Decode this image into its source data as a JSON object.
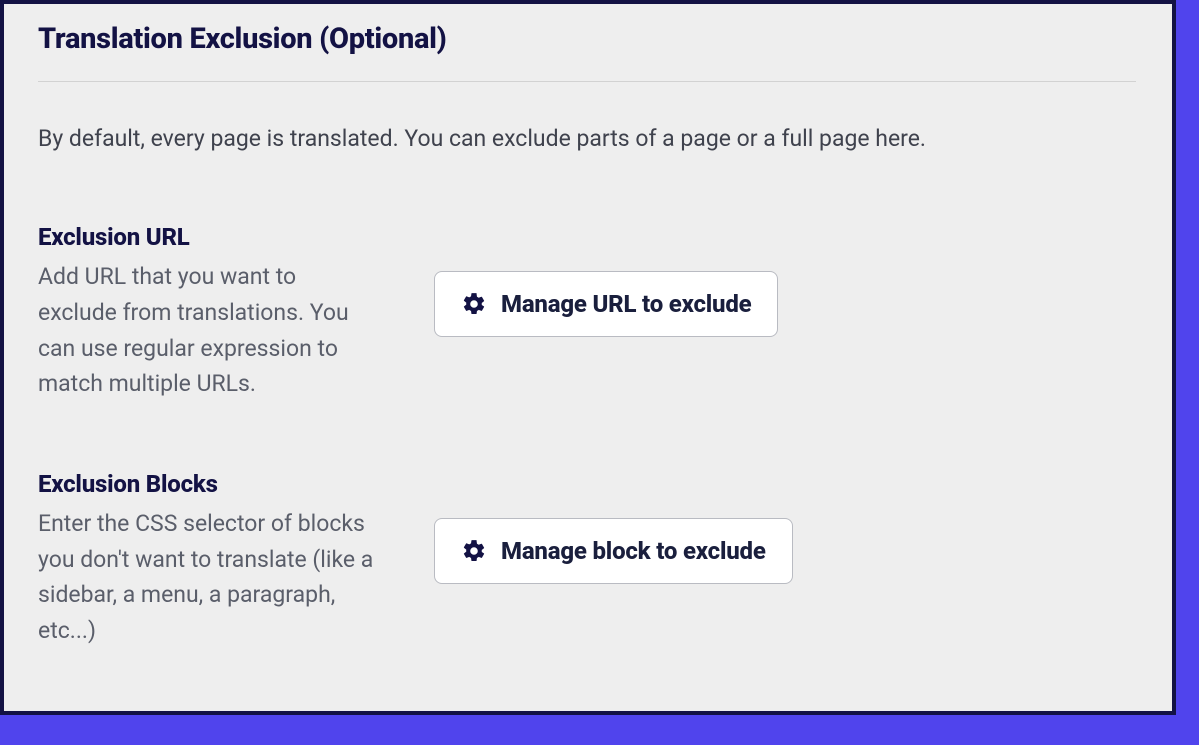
{
  "section": {
    "title": "Translation Exclusion (Optional)",
    "description": "By default, every page is translated. You can exclude parts of a page or a full page here."
  },
  "exclusion_url": {
    "heading": "Exclusion URL",
    "description": "Add URL that you want to exclude from translations. You can use regular expression to match multiple URLs.",
    "button_label": "Manage URL to exclude"
  },
  "exclusion_blocks": {
    "heading": "Exclusion Blocks",
    "description": "Enter the CSS selector of blocks you don't want to translate (like a sidebar, a menu, a paragraph, etc...)",
    "button_label": "Manage block to exclude"
  },
  "colors": {
    "backdrop": "#5044ed",
    "panel_border": "#131244",
    "panel_bg": "#eeeeee"
  }
}
